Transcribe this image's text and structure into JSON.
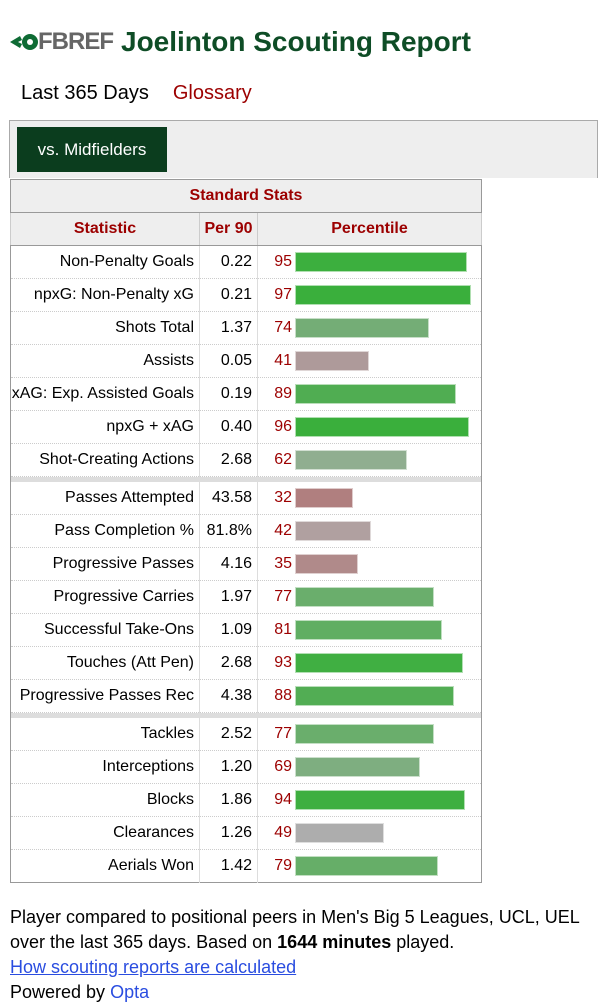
{
  "header": {
    "logo": "FBREF",
    "title": "Joelinton Scouting Report"
  },
  "subnav": {
    "period": "Last 365 Days",
    "glossary": "Glossary"
  },
  "tabs": [
    {
      "label": "vs. Midfielders",
      "active": true
    }
  ],
  "table": {
    "caption": "Standard Stats",
    "columns": [
      "Statistic",
      "Per 90",
      "Percentile"
    ],
    "groups": [
      [
        {
          "stat": "Non-Penalty Goals",
          "per90": "0.22",
          "pct": 95,
          "color": "#3caf3e"
        },
        {
          "stat": "npxG: Non-Penalty xG",
          "per90": "0.21",
          "pct": 97,
          "color": "#3aaf3c"
        },
        {
          "stat": "Shots Total",
          "per90": "1.37",
          "pct": 74,
          "color": "#74ad76"
        },
        {
          "stat": "Assists",
          "per90": "0.05",
          "pct": 41,
          "color": "#ae9a9a"
        },
        {
          "stat": "xAG: Exp. Assisted Goals",
          "per90": "0.19",
          "pct": 89,
          "color": "#50ad52"
        },
        {
          "stat": "npxG + xAG",
          "per90": "0.40",
          "pct": 96,
          "color": "#3aaf3c"
        },
        {
          "stat": "Shot-Creating Actions",
          "per90": "2.68",
          "pct": 62,
          "color": "#90ae90"
        }
      ],
      [
        {
          "stat": "Passes Attempted",
          "per90": "43.58",
          "pct": 32,
          "color": "#b07f7f"
        },
        {
          "stat": "Pass Completion %",
          "per90": "81.8%",
          "pct": 42,
          "color": "#b0a0a0"
        },
        {
          "stat": "Progressive Passes",
          "per90": "4.16",
          "pct": 35,
          "color": "#b08a8a"
        },
        {
          "stat": "Progressive Carries",
          "per90": "1.97",
          "pct": 77,
          "color": "#6aae6c"
        },
        {
          "stat": "Successful Take-Ons",
          "per90": "1.09",
          "pct": 81,
          "color": "#60ae62"
        },
        {
          "stat": "Touches (Att Pen)",
          "per90": "2.68",
          "pct": 93,
          "color": "#40af42"
        },
        {
          "stat": "Progressive Passes Rec",
          "per90": "4.38",
          "pct": 88,
          "color": "#52ad54"
        }
      ],
      [
        {
          "stat": "Tackles",
          "per90": "2.52",
          "pct": 77,
          "color": "#6aae6c"
        },
        {
          "stat": "Interceptions",
          "per90": "1.20",
          "pct": 69,
          "color": "#7eae80"
        },
        {
          "stat": "Blocks",
          "per90": "1.86",
          "pct": 94,
          "color": "#3eaf40"
        },
        {
          "stat": "Clearances",
          "per90": "1.26",
          "pct": 49,
          "color": "#adadad"
        },
        {
          "stat": "Aerials Won",
          "per90": "1.42",
          "pct": 79,
          "color": "#66ae68"
        }
      ]
    ]
  },
  "footer": {
    "line1": "Player compared to positional peers in Men's Big 5 Leagues, UCL, UEL over the last 365 days. Based on ",
    "minutes": "1644 minutes",
    "line2": " played.",
    "link": "How scouting reports are calculated",
    "powered": "Powered by ",
    "opta": "Opta"
  }
}
